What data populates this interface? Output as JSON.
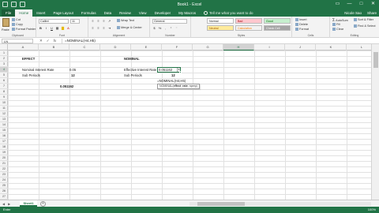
{
  "window": {
    "title": "Book1 - Excel"
  },
  "tabs": [
    "File",
    "Home",
    "Insert",
    "Page Layout",
    "Formulas",
    "Data",
    "Review",
    "View",
    "Developer",
    "My Macros"
  ],
  "tell_me": "Tell me what you want to do",
  "account": "Nicole Sao",
  "share": "Share",
  "ribbon": {
    "paste": "Paste",
    "cut": "Cut",
    "copy": "Copy",
    "format_painter": "Format Painter",
    "clipboard": "Clipboard",
    "font_name": "Calibri",
    "font_size": "11",
    "font": "Font",
    "wrap_text": "Wrap Text",
    "merge_center": "Merge & Center",
    "alignment": "Alignment",
    "number_format": "General",
    "number": "Number",
    "style_normal": "Normal",
    "style_bad": "Bad",
    "style_good": "Good",
    "style_neutral": "Neutral",
    "style_calculation": "Calculation",
    "style_check_cell": "Check Cell",
    "styles": "Styles",
    "insert": "Insert",
    "delete": "Delete",
    "format": "Format",
    "cells": "Cells",
    "autosum": "AutoSum",
    "fill": "Fill",
    "clear": "Clear",
    "sort_filter": "Sort & Filter",
    "find_select": "Find & Select",
    "editing": "Editing"
  },
  "formula_bar": {
    "name_box": "LN",
    "cancel": "✕",
    "enter": "✓",
    "fx": "fx",
    "formula": "=NOMINAL(H4,H5)"
  },
  "columns": [
    "A",
    "B",
    "C",
    "D",
    "E",
    "F",
    "G",
    "H",
    "I",
    "J",
    "K",
    "L"
  ],
  "selected_column": "H",
  "rows": [
    "1",
    "2",
    "3",
    "4",
    "5",
    "6",
    "7",
    "8",
    "9",
    "10",
    "11",
    "12",
    "13",
    "14",
    "15",
    "16",
    "17",
    "18",
    "19",
    "20",
    "21",
    "22",
    "23",
    "24",
    "25",
    "26",
    "27"
  ],
  "selected_row": "4",
  "cells": {
    "b2": "EFFECT",
    "b4": "Nominal Interest Rate",
    "b5": "Sub Periods",
    "d4": "0.05",
    "d5": "12",
    "d7": "0.051162",
    "h2": "NOMINAL",
    "h4": "Effective Interest Rate",
    "h5": "Sub Periods",
    "i4_active": "0.051162",
    "i5": "12",
    "i6": "=NOMINAL(H4,H5)",
    "tooltip_fn": "NOMINAL(",
    "tooltip_arg1": "effect_rate",
    "tooltip_rest": ", npery)"
  },
  "sheet_tab": "Sheet1",
  "status": "Enter",
  "zoom": "100%"
}
